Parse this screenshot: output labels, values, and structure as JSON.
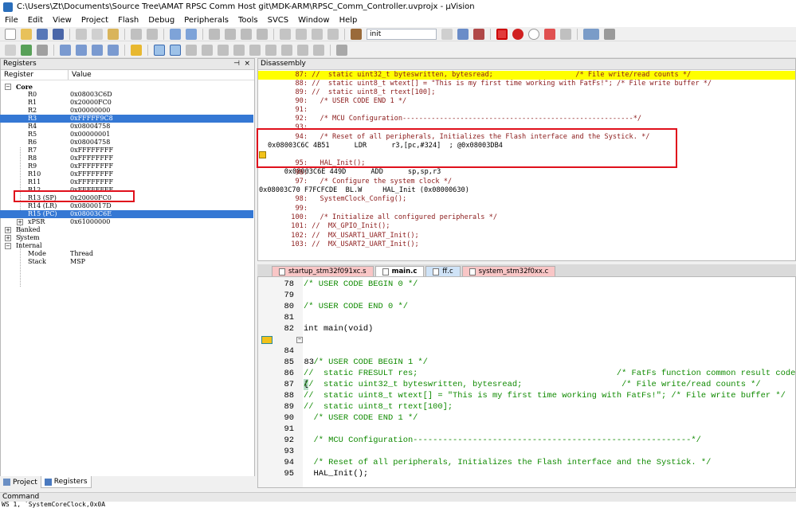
{
  "window": {
    "title": "C:\\Users\\Zt\\Documents\\Source Tree\\AMAT RPSC Comm Host git\\MDK-ARM\\RPSC_Comm_Controller.uvprojx - µVision"
  },
  "menu": [
    "File",
    "Edit",
    "View",
    "Project",
    "Flash",
    "Debug",
    "Peripherals",
    "Tools",
    "SVCS",
    "Window",
    "Help"
  ],
  "toolbar": {
    "target_combo": "init"
  },
  "registers_panel": {
    "title": "Registers",
    "col_register": "Register",
    "col_value": "Value",
    "core_label": "Core",
    "rows": [
      {
        "name": "R0",
        "value": "0x08003C6D"
      },
      {
        "name": "R1",
        "value": "0x20000FC0"
      },
      {
        "name": "R2",
        "value": "0x00000000"
      },
      {
        "name": "R3",
        "value": "0xFFFFF9C8",
        "selected": true
      },
      {
        "name": "R4",
        "value": "0x08004758"
      },
      {
        "name": "R5",
        "value": "0x00000001"
      },
      {
        "name": "R6",
        "value": "0x08004758"
      },
      {
        "name": "R7",
        "value": "0xFFFFFFFF"
      },
      {
        "name": "R8",
        "value": "0xFFFFFFFF"
      },
      {
        "name": "R9",
        "value": "0xFFFFFFFF"
      },
      {
        "name": "R10",
        "value": "0xFFFFFFFF"
      },
      {
        "name": "R11",
        "value": "0xFFFFFFFF"
      },
      {
        "name": "R12",
        "value": "0xFFFFFFFF"
      },
      {
        "name": "R13 (SP)",
        "value": "0x20000FC0"
      },
      {
        "name": "R14 (LR)",
        "value": "0x0800017D"
      },
      {
        "name": "R15 (PC)",
        "value": "0x08003C6E",
        "selected": true
      },
      {
        "name": "xPSR",
        "value": "0x61000000"
      }
    ],
    "groups": [
      "Banked",
      "System",
      "Internal"
    ],
    "internal": [
      {
        "name": "Mode",
        "value": "Thread"
      },
      {
        "name": "Stack",
        "value": "MSP"
      }
    ],
    "tabs": [
      "Project",
      "Registers"
    ]
  },
  "disassembly": {
    "title": "Disassembly",
    "lines": [
      {
        "num": "87:",
        "text": " //  static uint32_t byteswritten, bytesread;                    /* File write/read counts */",
        "hl": true
      },
      {
        "num": "88:",
        "text": " //  static uint8_t wtext[] = \"This is my first time working with FatFs!\"; /* File write buffer */"
      },
      {
        "num": "89:",
        "text": " //  static uint8_t rtext[100];"
      },
      {
        "num": "90:",
        "text": "   /* USER CODE END 1 */"
      },
      {
        "num": "91:",
        "text": ""
      },
      {
        "num": "92:",
        "text": "   /* MCU Configuration--------------------------------------------------------*/"
      },
      {
        "num": "93:",
        "text": ""
      },
      {
        "num": "94:",
        "text": "   /* Reset of all peripherals, Initializes the Flash interface and the Systick. */"
      },
      {
        "asm": "0x08003C6C 4B51      LDR      r3,[pc,#324]  ; @0x08003DB4"
      },
      {
        "asm": "0x08003C6E 449D      ADD      sp,sp,r3",
        "arrow": true
      },
      {
        "num": "95:",
        "text": "   HAL_Init();"
      },
      {
        "num": "96:",
        "text": ""
      },
      {
        "num": "97:",
        "text": "   /* Configure the system clock */"
      },
      {
        "asm": "0x08003C70 F7FCFCDE  BL.W     HAL_Init (0x08000630)"
      },
      {
        "num": "98:",
        "text": "   SystemClock_Config();"
      },
      {
        "num": "99:",
        "text": ""
      },
      {
        "num": "100:",
        "text": "   /* Initialize all configured peripherals */"
      },
      {
        "num": "101:",
        "text": " //  MX_GPIO_Init();"
      },
      {
        "num": "102:",
        "text": " //  MX_USART1_UART_Init();"
      },
      {
        "num": "103:",
        "text": " //  MX_USART2_UART_Init();"
      }
    ]
  },
  "editor": {
    "tabs": [
      {
        "label": "startup_stm32f091xc.s",
        "color": "#f9c6c6"
      },
      {
        "label": "main.c",
        "color": "#ffffff",
        "active": true
      },
      {
        "label": "ff.c",
        "color": "#cfe3f7"
      },
      {
        "label": "system_stm32f0xx.c",
        "color": "#f9c6c6"
      }
    ],
    "lines": [
      {
        "n": "78",
        "code": "/* USER CODE BEGIN 0 */"
      },
      {
        "n": "79",
        "code": ""
      },
      {
        "n": "80",
        "code": "/* USER CODE END 0 */"
      },
      {
        "n": "81",
        "code": ""
      },
      {
        "n": "82",
        "code": "int main(void)",
        "kw": true
      },
      {
        "n": "83",
        "code": "{",
        "kw": true,
        "current": true
      },
      {
        "n": "84",
        "code": ""
      },
      {
        "n": "85",
        "code": "  /* USER CODE BEGIN 1 */"
      },
      {
        "n": "86",
        "code": "//  static FRESULT res;                                        /* FatFs function common result code */"
      },
      {
        "n": "87",
        "code": "//  static uint32_t byteswritten, bytesread;                    /* File write/read counts */"
      },
      {
        "n": "88",
        "code": "//  static uint8_t wtext[] = \"This is my first time working with FatFs!\"; /* File write buffer */"
      },
      {
        "n": "89",
        "code": "//  static uint8_t rtext[100];"
      },
      {
        "n": "90",
        "code": "  /* USER CODE END 1 */"
      },
      {
        "n": "91",
        "code": ""
      },
      {
        "n": "92",
        "code": "  /* MCU Configuration--------------------------------------------------------*/"
      },
      {
        "n": "93",
        "code": ""
      },
      {
        "n": "94",
        "code": "  /* Reset of all peripherals, Initializes the Flash interface and the Systick. */"
      },
      {
        "n": "95",
        "code": "  HAL_Init();",
        "kw": true
      }
    ]
  },
  "command": {
    "title": "Command",
    "text": "WS 1, `SystemCoreClock,0x0A"
  },
  "colors": {
    "accent_selection": "#3578d4",
    "highlight_line": "#ffff00",
    "annotation_red": "#e0101c",
    "comment_green": "#0f8a00",
    "disasm_source": "#8b1a1a"
  }
}
